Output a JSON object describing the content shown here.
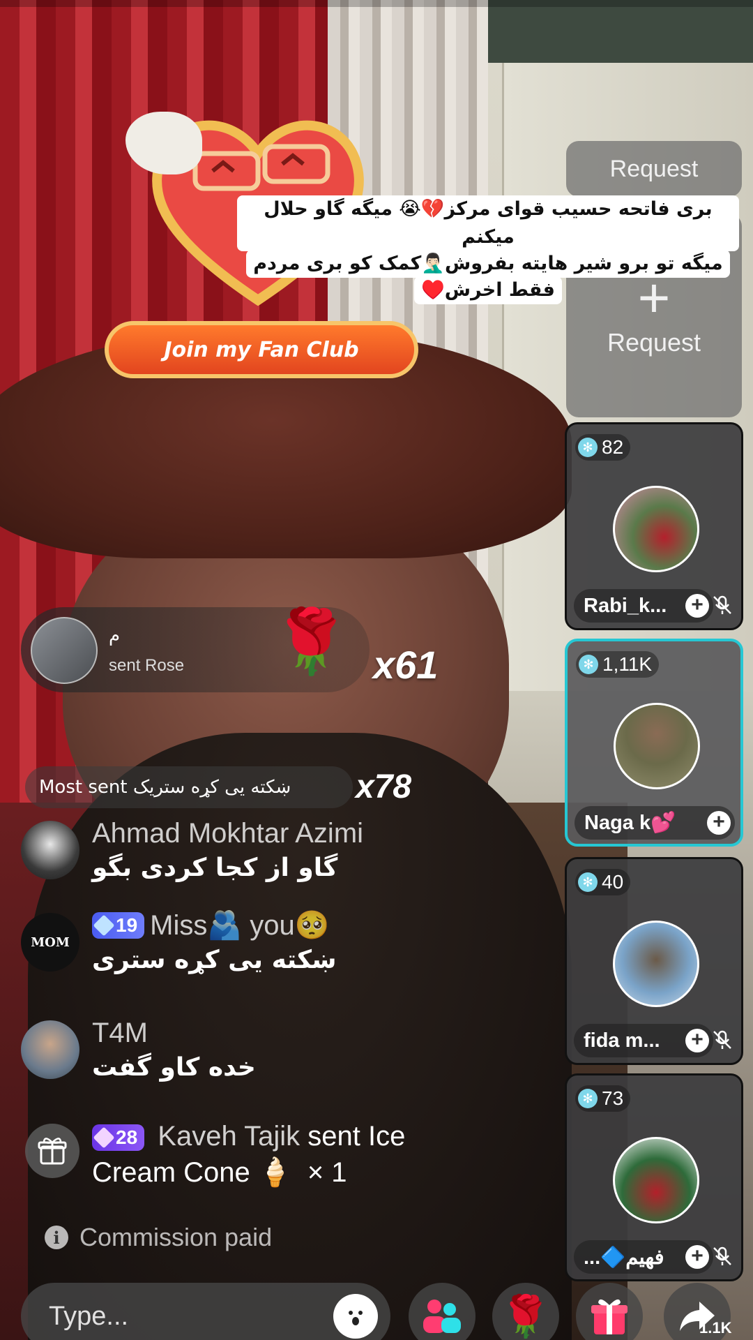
{
  "fan_club": {
    "button_label": "Join my Fan Club"
  },
  "caption": {
    "lines": [
      "بری فاتحه حسیب قوای مرکز💔😭 میگه گاو حلال میکنم",
      "میگه تو برو شیر هایته بفروش🤦🏻‍♂️کمک کو بری مردم",
      "فقط اخرش♥️"
    ]
  },
  "requests": {
    "top_label": "Request",
    "big_label": "Request"
  },
  "guests": [
    {
      "score": "82",
      "name": "Rabi_k...",
      "muted": true
    },
    {
      "score": "1,11K",
      "name": "Naga k💕",
      "muted": false,
      "active": true
    },
    {
      "score": "40",
      "name": "fida m...",
      "muted": true
    },
    {
      "score": "73",
      "name": "فهیم🔷...",
      "muted": true
    }
  ],
  "gift_banner": {
    "sender": "م",
    "text": "sent Rose",
    "count": "x61",
    "gift_icon": "rose-icon"
  },
  "most_sent": {
    "text": "Most sent ښکته یی کړه ستریک",
    "count": "x78"
  },
  "chat": [
    {
      "user": "Ahmad Mokhtar Azimi",
      "message": "گاو از کجا کردی بگو"
    },
    {
      "user": "Miss🫂 you🥺",
      "badge": "19",
      "message": "ښکته یی کړه ستری"
    },
    {
      "user": "T4M",
      "message": "خده کاو گفت"
    }
  ],
  "gift_event": {
    "badge": "28",
    "user": "Kaveh Tajik",
    "text": "sent Ice",
    "text2": "Cream Cone",
    "emoji": "🍦",
    "count": "× 1"
  },
  "commission": {
    "text": "Commission paid"
  },
  "bottom_bar": {
    "placeholder": "Type...",
    "share_count": "1.1K"
  },
  "avatar_labels": {
    "mom_text": "MOM"
  },
  "colors": {
    "active_border": "#26c7d3",
    "badge_blue": "#4a5cf0",
    "badge_purple": "#6b35e6",
    "fan_orange": "#ff7a2c"
  }
}
